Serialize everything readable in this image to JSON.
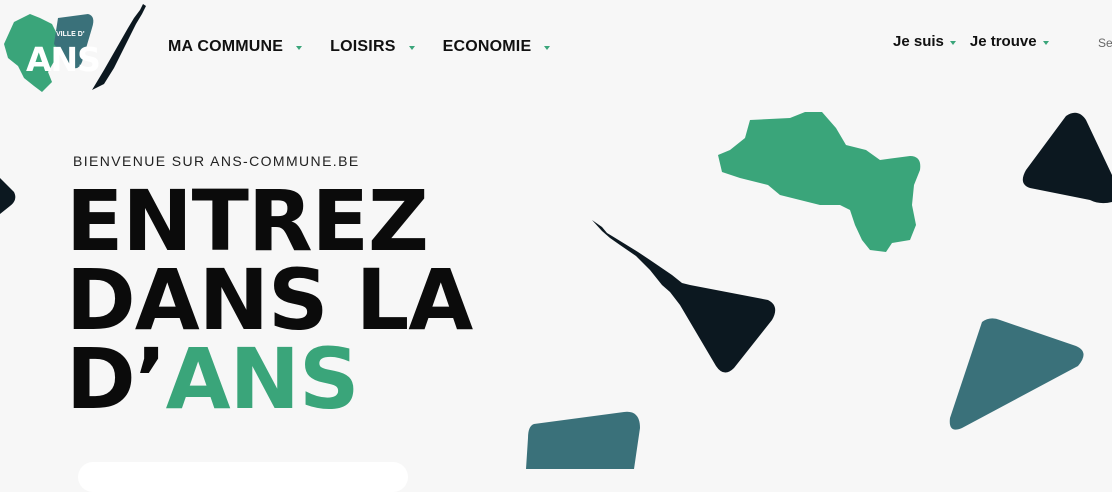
{
  "logo": {
    "small_text": "VILLE D'",
    "main_text": "ANS"
  },
  "nav": {
    "items": [
      {
        "label": "MA COMMUNE"
      },
      {
        "label": "LOISIRS"
      },
      {
        "label": "ECONOMIE"
      }
    ]
  },
  "utility_nav": {
    "items": [
      {
        "label": "Je suis"
      },
      {
        "label": "Je trouve"
      }
    ],
    "search_partial": "Se"
  },
  "hero": {
    "kicker": "BIENVENUE SUR ANS-COMMUNE.BE",
    "line1": "ENTREZ",
    "line2": "DANS LA",
    "line3_prefix": "D’",
    "line3_accent": "ANS"
  },
  "colors": {
    "accent_green": "#3aa57a",
    "dark": "#0c1820",
    "teal": "#3a717a",
    "background": "#f7f7f7"
  },
  "icons": {
    "nav_caret": "caret-down-icon",
    "logo": "ans-logo-icon"
  }
}
